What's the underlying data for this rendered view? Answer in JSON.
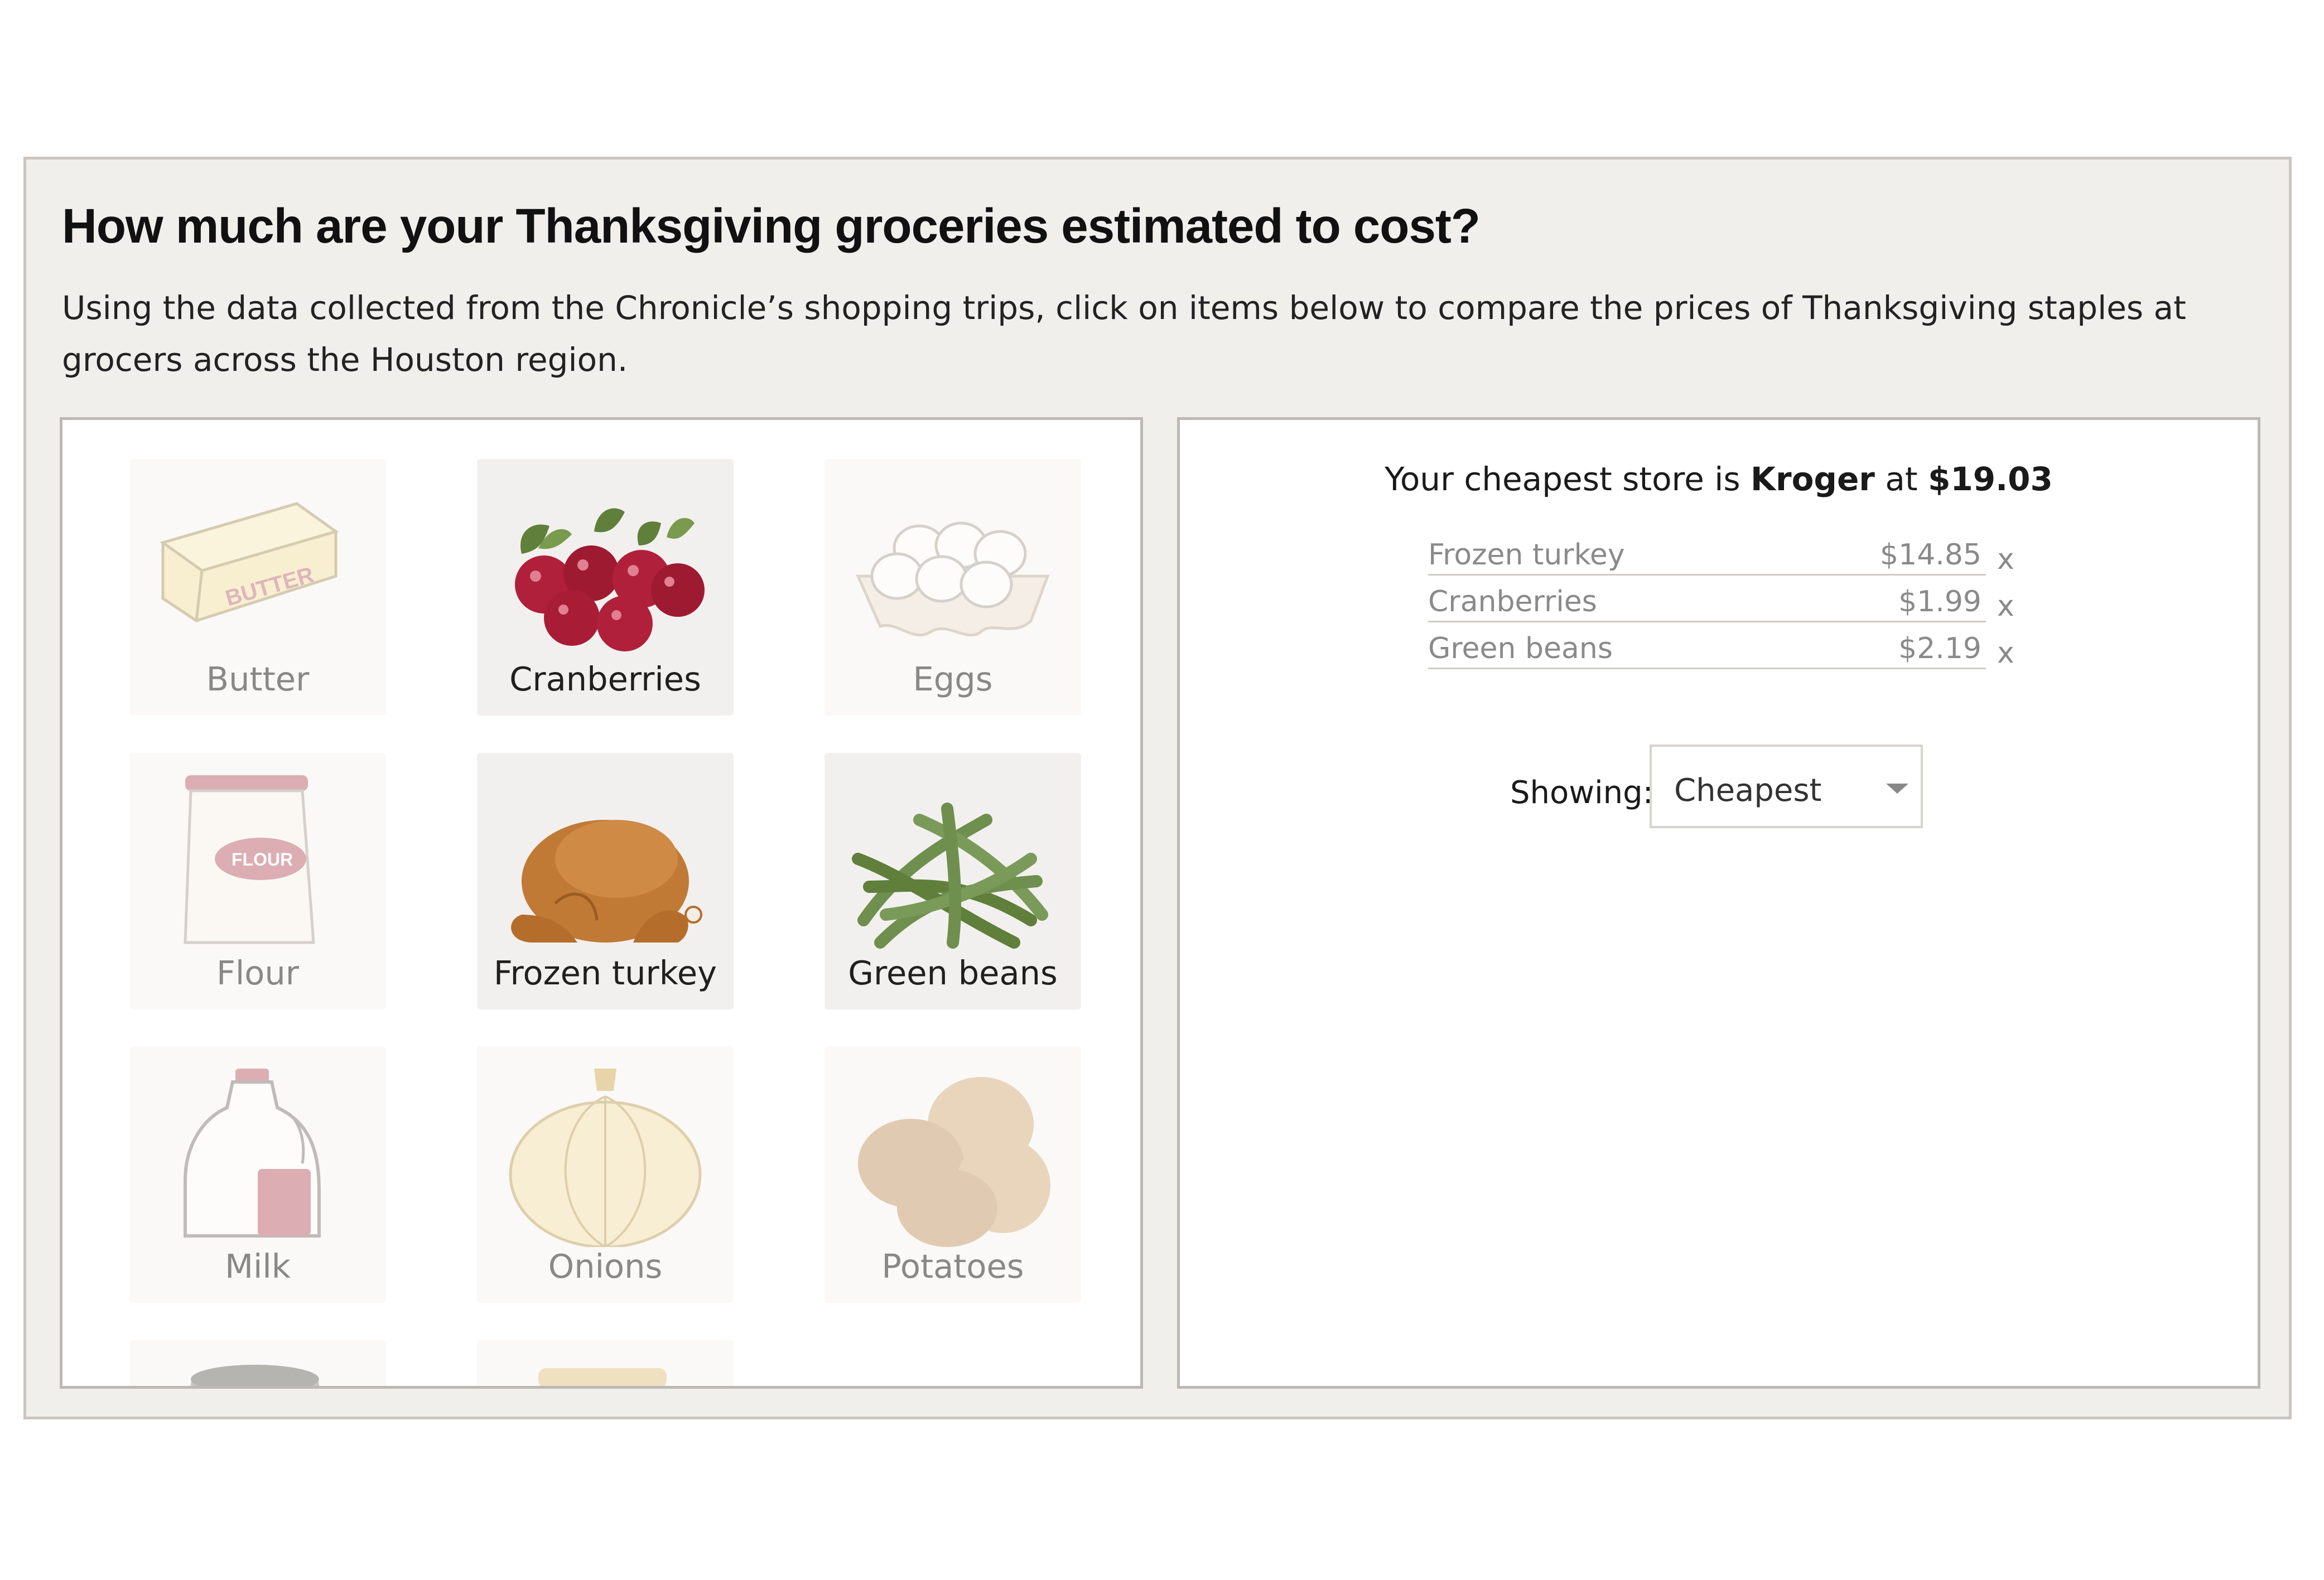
{
  "header": {
    "title": "How much are your Thanksgiving groceries estimated to cost?",
    "subtitle": "Using the data collected from the Chronicle’s shopping trips, click on items below to compare the prices of Thanksgiving staples at grocers across the Houston region."
  },
  "grid": {
    "items": [
      {
        "label": "Butter",
        "selected": false,
        "icon": "butter-icon"
      },
      {
        "label": "Cranberries",
        "selected": true,
        "icon": "cranberries-icon"
      },
      {
        "label": "Eggs",
        "selected": false,
        "icon": "eggs-icon"
      },
      {
        "label": "Flour",
        "selected": false,
        "icon": "flour-icon"
      },
      {
        "label": "Frozen turkey",
        "selected": true,
        "icon": "turkey-icon"
      },
      {
        "label": "Green beans",
        "selected": true,
        "icon": "green-beans-icon"
      },
      {
        "label": "Milk",
        "selected": false,
        "icon": "milk-icon"
      },
      {
        "label": "Onions",
        "selected": false,
        "icon": "onion-icon"
      },
      {
        "label": "Potatoes",
        "selected": false,
        "icon": "potatoes-icon"
      }
    ],
    "partial_icons": [
      "can-icon",
      "jar-icon"
    ]
  },
  "summary": {
    "prefix": "Your cheapest store is",
    "store": "Kroger",
    "connector": "at",
    "total": "$19.03",
    "items": [
      {
        "name": "Frozen turkey",
        "price": "$14.85",
        "remove": "x"
      },
      {
        "name": "Cranberries",
        "price": "$1.99",
        "remove": "x"
      },
      {
        "name": "Green beans",
        "price": "$2.19",
        "remove": "x"
      }
    ]
  },
  "filter": {
    "label": "Showing:",
    "value": "Cheapest"
  },
  "colors": {
    "frame_bg": "#f1efec",
    "selected_tile_bg": "#f2f0ee",
    "cranberry": "#b0203a",
    "turkey": "#c07a35",
    "green_bean": "#6f8f4e",
    "flour_badge": "#c4707c"
  }
}
